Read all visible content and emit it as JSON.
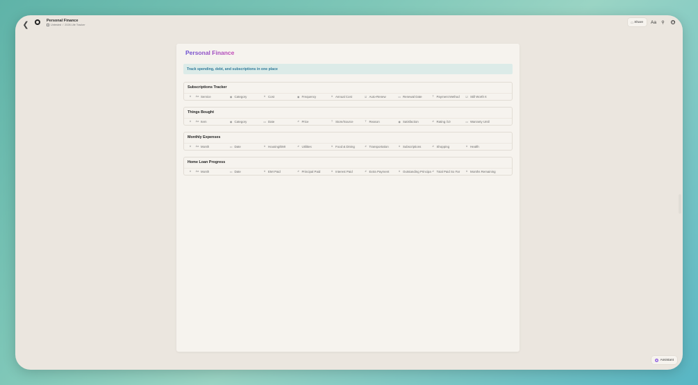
{
  "window": {
    "title": "Personal Finance",
    "subtitle_primary": "Untested",
    "subtitle_sep": "/",
    "subtitle_secondary": "2026 Life Tracker",
    "share_label": "Share",
    "font_label": "Aa",
    "assistant_label": "Assistant"
  },
  "page": {
    "title": "Personal Finance",
    "callout": "Track spending, debt, and subscriptions in one place"
  },
  "databases": [
    {
      "title": "Subscriptions Tracker",
      "columns": [
        {
          "icon": "#",
          "label": ""
        },
        {
          "icon": "Aa",
          "label": "Service"
        },
        {
          "icon": "◉",
          "label": "Category"
        },
        {
          "icon": "#",
          "label": "Cost"
        },
        {
          "icon": "◉",
          "label": "Frequency"
        },
        {
          "icon": "#",
          "label": "Annual Cost"
        },
        {
          "icon": "☑",
          "label": "Auto-Renew"
        },
        {
          "icon": "▭",
          "label": "Renewal Date"
        },
        {
          "icon": "T",
          "label": "Payment Method"
        },
        {
          "icon": "☑",
          "label": "Still Worth It"
        }
      ]
    },
    {
      "title": "Things Bought",
      "columns": [
        {
          "icon": "#",
          "label": ""
        },
        {
          "icon": "Aa",
          "label": "Item"
        },
        {
          "icon": "◉",
          "label": "Category"
        },
        {
          "icon": "▭",
          "label": "Date"
        },
        {
          "icon": "#",
          "label": "Price"
        },
        {
          "icon": "T",
          "label": "Store/Source"
        },
        {
          "icon": "T",
          "label": "Reason"
        },
        {
          "icon": "◉",
          "label": "Satisfaction"
        },
        {
          "icon": "#",
          "label": "Rating /10"
        },
        {
          "icon": "▭",
          "label": "Warranty Until"
        }
      ]
    },
    {
      "title": "Monthly Expenses",
      "columns": [
        {
          "icon": "#",
          "label": ""
        },
        {
          "icon": "Aa",
          "label": "Month"
        },
        {
          "icon": "▭",
          "label": "Date"
        },
        {
          "icon": "#",
          "label": "Housing/EMI"
        },
        {
          "icon": "#",
          "label": "Utilities"
        },
        {
          "icon": "#",
          "label": "Food & Dining"
        },
        {
          "icon": "#",
          "label": "Transportation"
        },
        {
          "icon": "#",
          "label": "Subscriptions"
        },
        {
          "icon": "#",
          "label": "Shopping"
        },
        {
          "icon": "#",
          "label": "Health"
        }
      ]
    },
    {
      "title": "Home Loan Progress",
      "columns": [
        {
          "icon": "#",
          "label": ""
        },
        {
          "icon": "Aa",
          "label": "Month"
        },
        {
          "icon": "▭",
          "label": "Date"
        },
        {
          "icon": "#",
          "label": "EMI Paid"
        },
        {
          "icon": "#",
          "label": "Principal Paid"
        },
        {
          "icon": "#",
          "label": "Interest Paid"
        },
        {
          "icon": "#",
          "label": "Extra Payment"
        },
        {
          "icon": "#",
          "label": "Outstanding Principal"
        },
        {
          "icon": "#",
          "label": "Total Paid So Far"
        },
        {
          "icon": "#",
          "label": "Months Remaining"
        }
      ]
    }
  ]
}
